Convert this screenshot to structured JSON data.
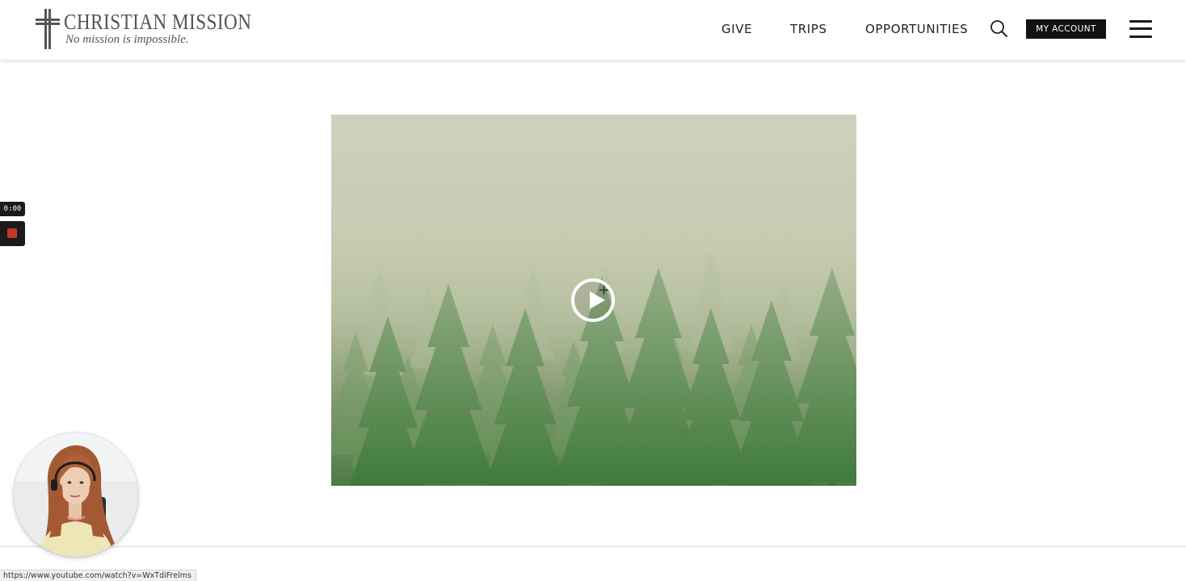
{
  "header": {
    "logo": {
      "title": "CHRISTIAN MISSION",
      "tagline": "No mission is impossible.",
      "icon": "cross-icon"
    },
    "nav": [
      {
        "label": "GIVE"
      },
      {
        "label": "TRIPS"
      },
      {
        "label": "OPPORTUNITIES"
      }
    ],
    "search_icon": "search-icon",
    "account_label": "MY ACCOUNT",
    "menu_icon": "hamburger-menu-icon"
  },
  "video": {
    "thumbnail": "misty pine forest",
    "play_icon": "play-icon"
  },
  "recorder": {
    "timer": "0:00",
    "stop_icon": "stop-icon"
  },
  "status_bar": {
    "url": "https://www.youtube.com/watch?v=WxTdiFrelms"
  },
  "colors": {
    "header_bg": "#ffffff",
    "account_button_bg": "#111111",
    "text_dark": "#222222",
    "record_red": "#c0392b"
  }
}
